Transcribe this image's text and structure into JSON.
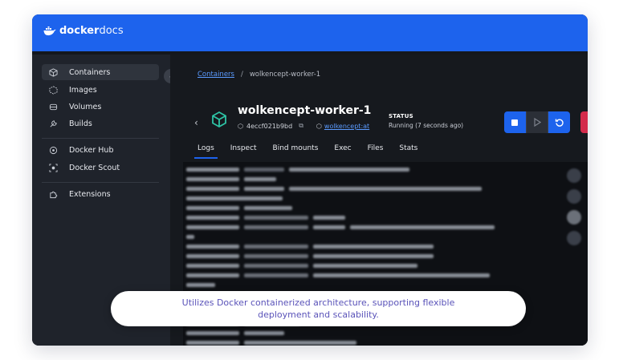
{
  "brand": {
    "bold": "docker",
    "light": "docs"
  },
  "sidebar": {
    "items": [
      {
        "label": "Containers",
        "icon": "cube-icon",
        "active": true
      },
      {
        "label": "Images",
        "icon": "image-cube-icon"
      },
      {
        "label": "Volumes",
        "icon": "volume-icon"
      },
      {
        "label": "Builds",
        "icon": "wrench-icon"
      },
      {
        "label": "Docker Hub",
        "icon": "hub-icon"
      },
      {
        "label": "Docker Scout",
        "icon": "scout-icon"
      },
      {
        "label": "Extensions",
        "icon": "puzzle-icon"
      }
    ]
  },
  "breadcrumb": {
    "parent": "Containers",
    "separator": "/",
    "current": "wolkencept-worker-1"
  },
  "container": {
    "name": "wolkencept-worker-1",
    "id": "4eccf021b9bd",
    "image": "wolkencept:at",
    "status_label": "STATUS",
    "status_value": "Running (7 seconds ago)"
  },
  "tabs": [
    "Logs",
    "Inspect",
    "Bind mounts",
    "Exec",
    "Files",
    "Stats"
  ],
  "banner": {
    "line1": "Utilizes Docker containerized architecture, supporting flexible",
    "line2": "deployment and scalability."
  },
  "colors": {
    "accent": "#1d63ed",
    "danger": "#d42b4b",
    "banner_text": "#5a53b9"
  }
}
